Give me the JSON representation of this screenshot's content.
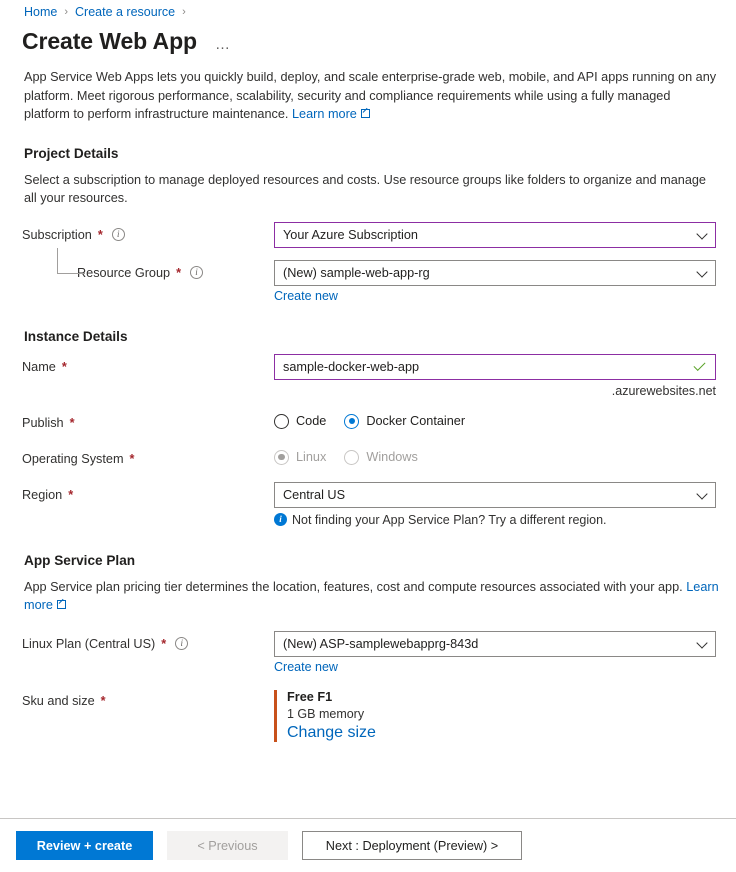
{
  "breadcrumb": {
    "items": [
      {
        "label": "Home"
      },
      {
        "label": "Create a resource"
      }
    ],
    "separator": "›"
  },
  "header": {
    "title": "Create Web App",
    "more_menu": "…"
  },
  "description": {
    "line1": "App Service Web Apps lets you quickly build, deploy, and scale enterprise-grade web, mobile, and API apps running on",
    "line2": "any platform. Meet rigorous performance, scalability, security and compliance requirements while using a fully managed",
    "line3": "platform to perform infrastructure maintenance. ",
    "learn_more": "Learn more"
  },
  "project_details": {
    "heading": "Project Details",
    "description": "Select a subscription to manage deployed resources and costs. Use resource groups like folders to organize and manage all your resources.",
    "subscription": {
      "label": "Subscription",
      "required": "*",
      "info": "i",
      "value": "Your Azure Subscription"
    },
    "resource_group": {
      "label": "Resource Group",
      "required": "*",
      "info": "i",
      "value": "(New) sample-web-app-rg",
      "create_new": "Create new"
    }
  },
  "instance_details": {
    "heading": "Instance Details",
    "name": {
      "label": "Name",
      "required": "*",
      "value": "sample-docker-web-app",
      "suffix": ".azurewebsites.net"
    },
    "publish": {
      "label": "Publish",
      "required": "*",
      "options": [
        {
          "label": "Code",
          "checked": false
        },
        {
          "label": "Docker Container",
          "checked": true
        }
      ]
    },
    "operating_system": {
      "label": "Operating System",
      "required": "*",
      "disabled": true,
      "options": [
        {
          "label": "Linux",
          "checked": true
        },
        {
          "label": "Windows",
          "checked": false
        }
      ]
    },
    "region": {
      "label": "Region",
      "required": "*",
      "value": "Central US",
      "note": "Not finding your App Service Plan? Try a different region.",
      "note_icon": "i"
    }
  },
  "app_service_plan": {
    "heading": "App Service Plan",
    "description": "App Service plan pricing tier determines the location, features, cost and compute resources associated with your app.",
    "learn_more": "Learn more",
    "linux_plan": {
      "label": "Linux Plan (Central US)",
      "required": "*",
      "info": "i",
      "value": "(New) ASP-samplewebapprg-843d",
      "create_new": "Create new"
    },
    "sku": {
      "label": "Sku and size",
      "required": "*",
      "title": "Free F1",
      "memory": "1 GB memory",
      "change_link": "Change size",
      "accent_color": "#c8511b"
    }
  },
  "footer": {
    "review_create": "Review + create",
    "previous": "< Previous",
    "next": "Next : Deployment (Preview) >"
  },
  "colors": {
    "primary": "#0078d4",
    "link": "#0066bb",
    "required": "#a4262c",
    "focus_border": "#8c2ea3",
    "valid_check": "#5ba32b",
    "sku_accent": "#c8511b"
  }
}
